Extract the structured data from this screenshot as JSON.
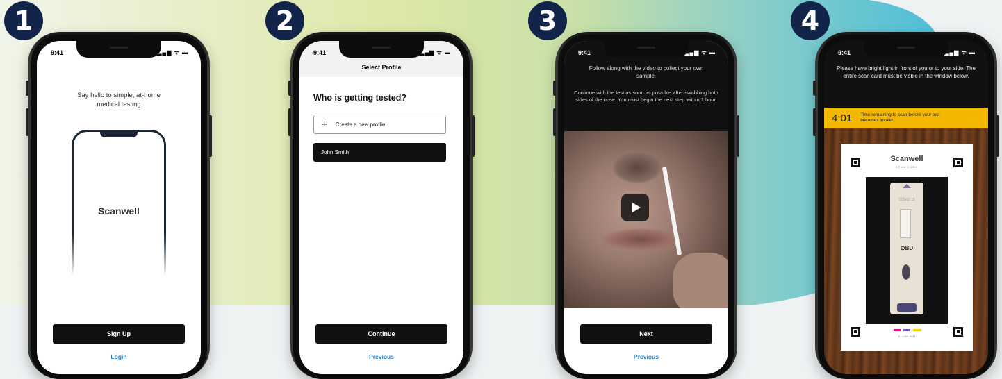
{
  "colors": {
    "badge": "#13244a",
    "link": "#2a80c7",
    "timer_bar": "#f3b700"
  },
  "steps": [
    "1",
    "2",
    "3",
    "4"
  ],
  "status": {
    "time": "9:41",
    "icons": "signal-wifi-battery"
  },
  "screen1": {
    "headline": "Say hello to simple, at-home medical testing",
    "logo": "Scanwell",
    "signup": "Sign Up",
    "login": "Login"
  },
  "screen2": {
    "header": "Select Profile",
    "question": "Who is getting tested?",
    "create_profile": "Create a new profile",
    "profile_name": "John Smith",
    "continue": "Continue",
    "previous": "Previous"
  },
  "screen3": {
    "instruction1": "Follow along with the video to collect your own sample.",
    "instruction2": "Continue with the test as soon as possible after swabbing both sides of the nose. You must begin the next step within 1 hour.",
    "next": "Next",
    "previous": "Previous"
  },
  "screen4": {
    "instruction": "Please have bright light in front of you or to your side. The entire scan card must be visble in the window below.",
    "timer": "4:01",
    "timer_text": "Time remaining to scan before your test becomes invalid.",
    "card_logo": "Scanwell",
    "card_sub": "SCAN CARD",
    "cassette_label": "COVID 19",
    "brand": "BD",
    "card_code": "A • 1455-0031"
  }
}
